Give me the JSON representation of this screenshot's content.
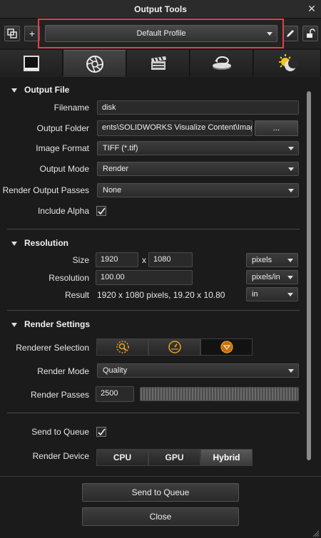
{
  "window": {
    "title": "Output Tools"
  },
  "toolbar": {
    "profile": "Default Profile",
    "plus": "+"
  },
  "output_file": {
    "header": "Output File",
    "filename_label": "Filename",
    "filename_value": "disk",
    "folder_label": "Output Folder",
    "folder_value": "ents\\SOLIDWORKS Visualize Content\\Images",
    "browse_label": "...",
    "image_format_label": "Image Format",
    "image_format_value": "TIFF (*.tif)",
    "output_mode_label": "Output Mode",
    "output_mode_value": "Render",
    "passes_label": "Render Output Passes",
    "passes_value": "None",
    "alpha_label": "Include Alpha",
    "alpha_checked": true
  },
  "resolution": {
    "header": "Resolution",
    "size_label": "Size",
    "width": "1920",
    "x_sep": "x",
    "height": "1080",
    "size_unit": "pixels",
    "resolution_label": "Resolution",
    "resolution_value": "100.00",
    "resolution_unit": "pixels/in",
    "result_label": "Result",
    "result_value": "1920 x 1080 pixels, 19.20 x 10.80",
    "result_unit": "in"
  },
  "render_settings": {
    "header": "Render Settings",
    "renderer_label": "Renderer Selection",
    "mode_label": "Render Mode",
    "mode_value": "Quality",
    "passes_label": "Render Passes",
    "passes_value": "2500"
  },
  "queue": {
    "send_label": "Send to Queue",
    "send_checked": true,
    "device_label": "Render Device",
    "devices": [
      "CPU",
      "GPU",
      "Hybrid"
    ],
    "device_selected": "Hybrid"
  },
  "footer": {
    "send_button": "Send to Queue",
    "close_button": "Close"
  },
  "colors": {
    "highlight": "#e0424a",
    "background": "#1b1b1b"
  }
}
